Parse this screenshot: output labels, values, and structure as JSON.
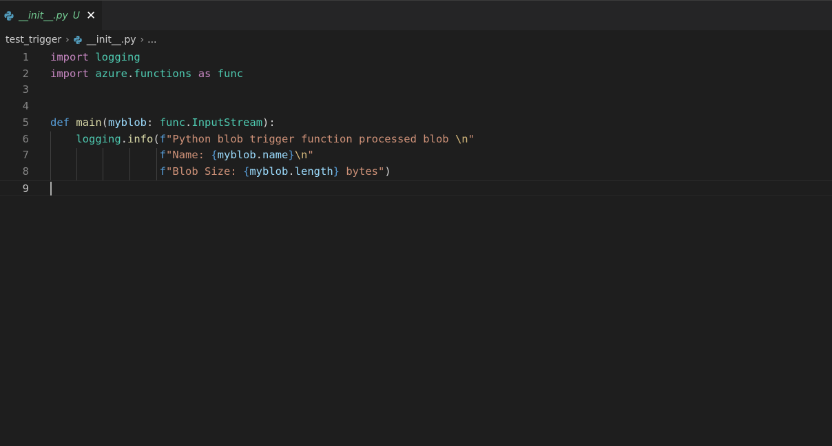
{
  "tab": {
    "title": "__init__.py",
    "badge": "U",
    "close_icon": "close-icon",
    "file_icon": "python-icon"
  },
  "breadcrumb": {
    "folder": "test_trigger",
    "file": "__init__.py",
    "more": "..."
  },
  "editor": {
    "current_line": 9,
    "lines": [
      {
        "number": "1",
        "code": "import logging"
      },
      {
        "number": "2",
        "code": "import azure.functions as func"
      },
      {
        "number": "3",
        "code": ""
      },
      {
        "number": "4",
        "code": ""
      },
      {
        "number": "5",
        "code": "def main(myblob: func.InputStream):"
      },
      {
        "number": "6",
        "code": "    logging.info(f\"Python blob trigger function processed blob \\n\""
      },
      {
        "number": "7",
        "code": "                 f\"Name: {myblob.name}\\n\""
      },
      {
        "number": "8",
        "code": "                 f\"Blob Size: {myblob.length} bytes\")"
      },
      {
        "number": "9",
        "code": ""
      }
    ]
  },
  "colors": {
    "background": "#1e1e1e",
    "tab_modified": "#73c991",
    "keyword": "#c586c0",
    "def_keyword": "#569cd6",
    "module": "#4ec9b0",
    "function": "#dcdcaa",
    "variable": "#9cdcfe",
    "string": "#ce9178",
    "escape": "#d7ba7d"
  }
}
